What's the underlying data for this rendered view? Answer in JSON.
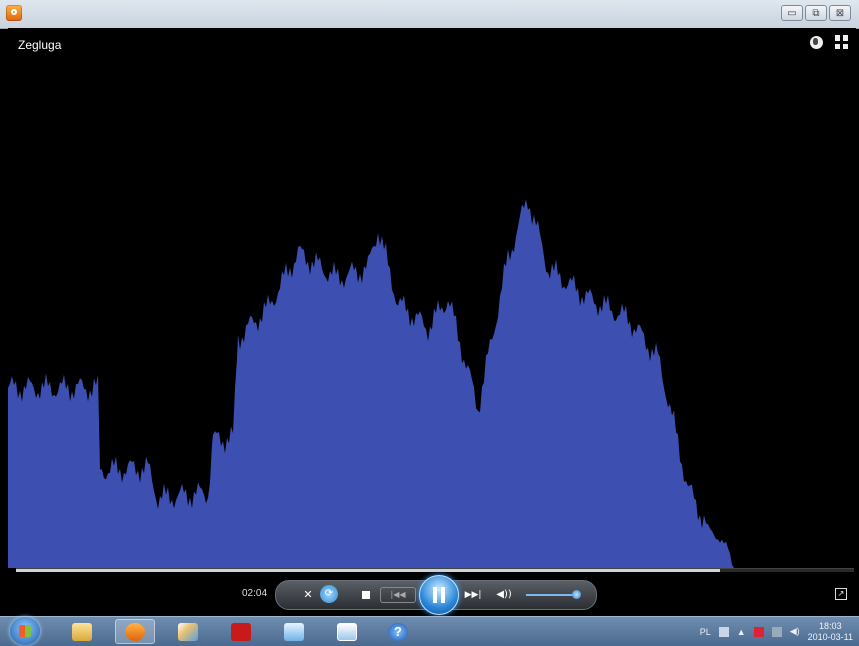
{
  "window": {
    "title_controls": [
      "▭",
      "⧉",
      "⊠"
    ]
  },
  "video": {
    "title": "Zegluga",
    "overlay_icons": [
      "globe-icon",
      "switch-to-library-icon"
    ]
  },
  "playback": {
    "time": "02:04",
    "progress_fraction": 0.84,
    "volume_fraction": 0.9,
    "state": "playing"
  },
  "controls": {
    "shuffle_glyph": "✕",
    "repeat_glyph": "⟳",
    "prev_glyph": "|◀◀",
    "next_glyph": "▶▶|",
    "volume_glyph": "◀))",
    "fullscreen_glyph": "↗"
  },
  "colors": {
    "visualization": "#3d4fb0",
    "accent": "#2a86d8"
  },
  "taskbar": {
    "apps": [
      "start-orb",
      "windows-explorer",
      "windows-media-player",
      "paint",
      "adobe-reader",
      "generic-app",
      "picture-viewer",
      "help"
    ],
    "active_app": "windows-media-player",
    "tray": {
      "language": "PL",
      "time": "18:03",
      "date": "2010-03-11"
    }
  }
}
